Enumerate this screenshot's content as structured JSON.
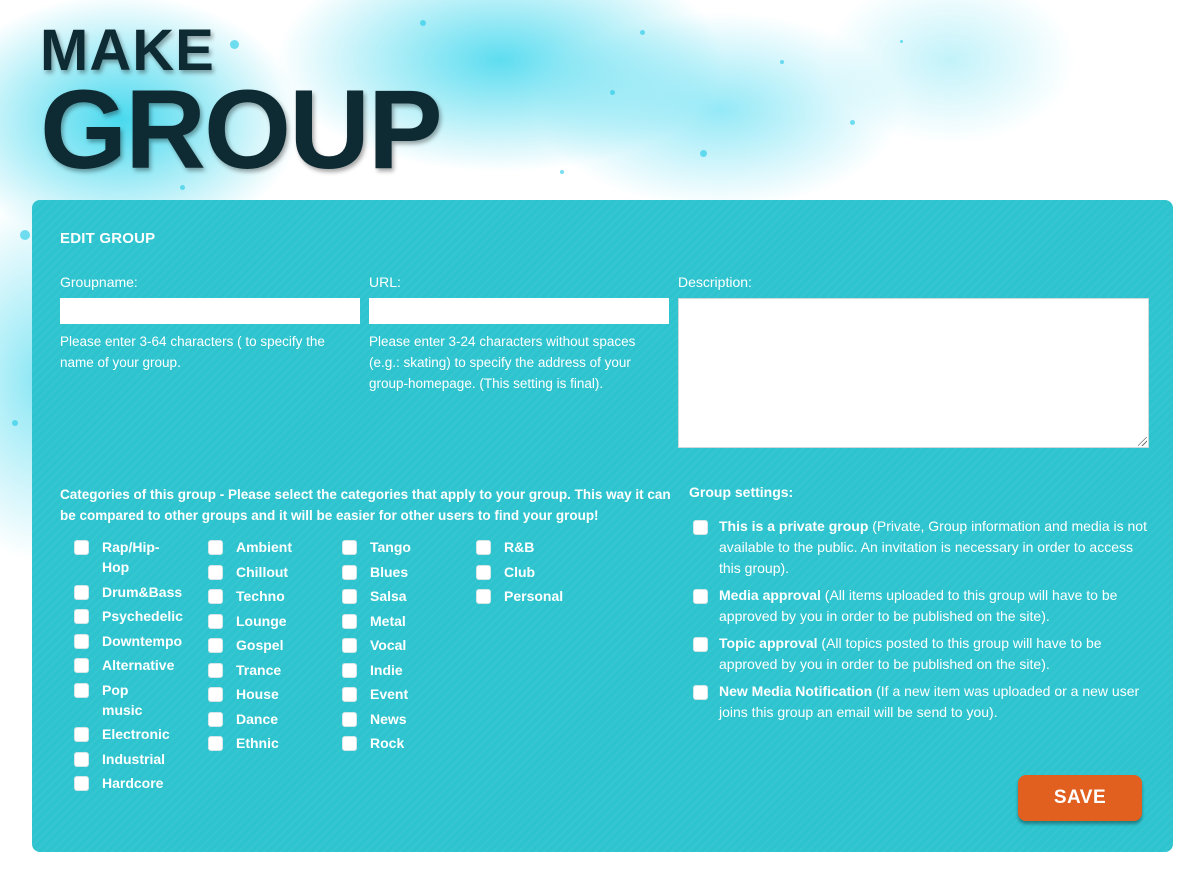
{
  "header": {
    "title_line1": "MAKE",
    "title_line2": "GROUP"
  },
  "panel": {
    "title": "EDIT GROUP"
  },
  "fields": {
    "groupname": {
      "label": "Groupname:",
      "value": "",
      "help": "Please enter 3-64 characters ( to specify the name of your group."
    },
    "url": {
      "label": "URL:",
      "value": "",
      "help": "Please enter 3-24 characters without spaces (e.g.: skating) to specify the address of your group-homepage. (This setting is final)."
    },
    "description": {
      "label": "Description:",
      "value": ""
    }
  },
  "categories": {
    "heading": "Categories of this group - Please select the categories that apply to your group. This way it can be compared to other groups and it will be easier for other users to find your group!",
    "columns": [
      [
        "Rap/Hip-Hop",
        "Drum&Bass",
        "Psychedelic",
        "Downtempo",
        "Alternative",
        "Pop music",
        "Electronic",
        "Industrial",
        "Hardcore"
      ],
      [
        "Ambient",
        "Chillout",
        "Techno",
        "Lounge",
        "Gospel",
        "Trance",
        "House",
        "Dance",
        "Ethnic"
      ],
      [
        "Tango",
        "Blues",
        "Salsa",
        "Metal",
        "Vocal",
        "Indie",
        "Event",
        "News",
        "Rock"
      ],
      [
        "R&B",
        "Club",
        "Personal"
      ]
    ]
  },
  "settings": {
    "heading": "Group settings:",
    "items": [
      {
        "title": "This is a private group",
        "detail": " (Private, Group information and media is not available to the public. An invitation is necessary in order to access this group).",
        "checked": false
      },
      {
        "title": "Media approval",
        "detail": " (All items uploaded to this group will have to be approved by you in order to be published on the site).",
        "checked": false
      },
      {
        "title": "Topic approval",
        "detail": " (All topics posted to this group will have to be approved by you in order to be published on the site).",
        "checked": false
      },
      {
        "title": "New Media Notification",
        "detail": " (If a new item was uploaded or a new user joins this group an email will be send to you).",
        "checked": false
      }
    ]
  },
  "actions": {
    "save_label": "SAVE"
  },
  "colors": {
    "panel": "#2ec4cf",
    "title": "#0e2b33",
    "save_button": "#e2601f",
    "splash": "#28d2eb"
  }
}
